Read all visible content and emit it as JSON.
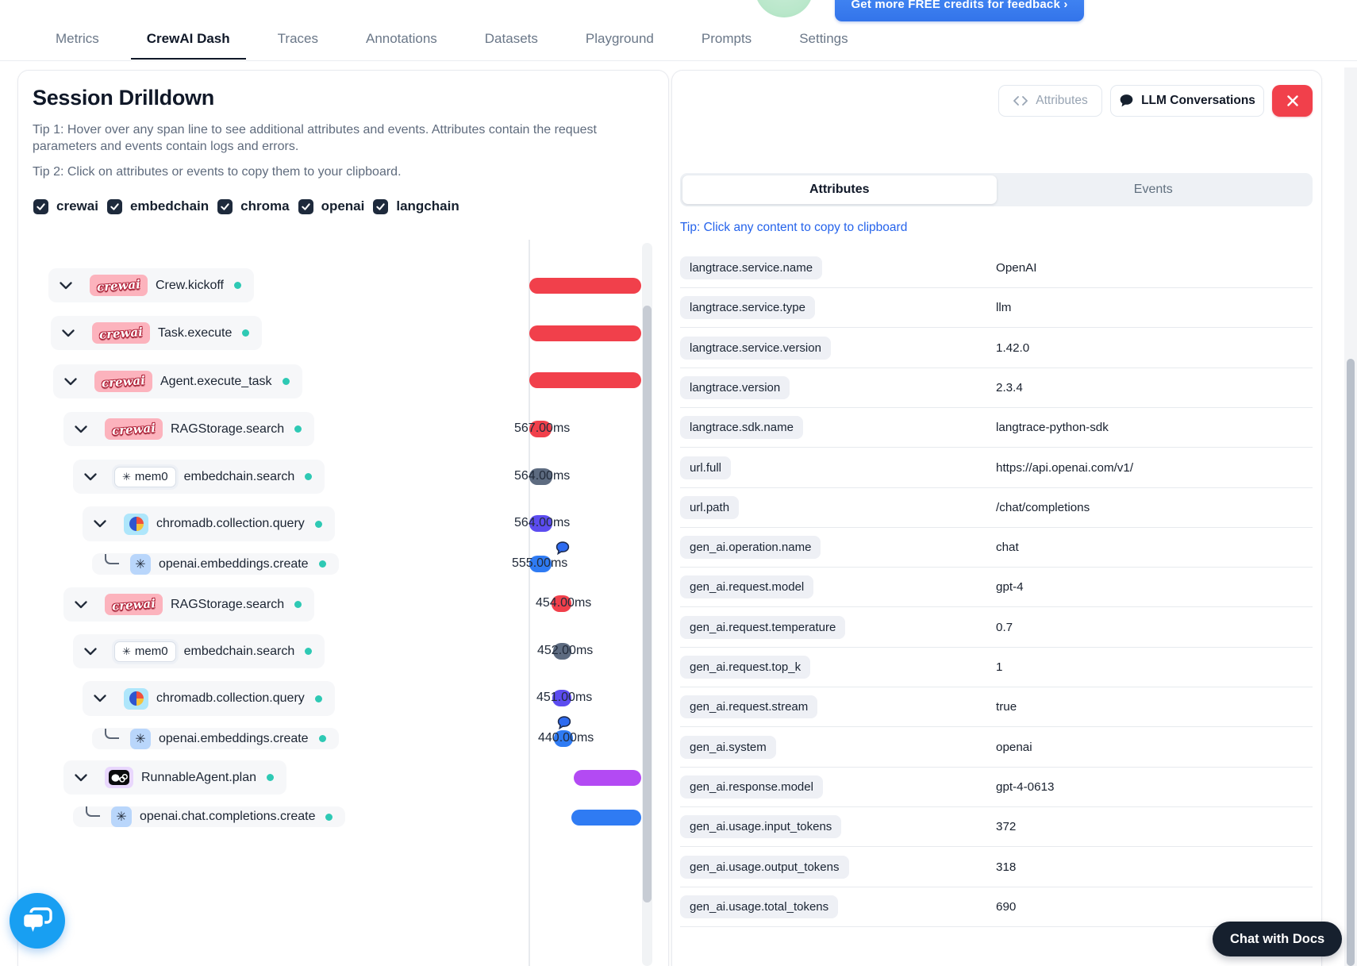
{
  "header": {
    "credits_button_label": "Get more FREE credits for feedback ›",
    "nav_tabs": [
      "Metrics",
      "CrewAI Dash",
      "Traces",
      "Annotations",
      "Datasets",
      "Playground",
      "Prompts",
      "Settings"
    ],
    "active_tab": "CrewAI Dash"
  },
  "session_panel": {
    "title": "Session Drilldown",
    "tip1": "Tip 1: Hover over any span line to see additional attributes and events. Attributes contain the request parameters and events contain logs and errors.",
    "tip2": "Tip 2: Click on attributes or events to copy them to your clipboard.",
    "filters": [
      {
        "label": "crewai",
        "checked": true
      },
      {
        "label": "embedchain",
        "checked": true
      },
      {
        "label": "chroma",
        "checked": true
      },
      {
        "label": "openai",
        "checked": true
      },
      {
        "label": "langchain",
        "checked": true
      }
    ],
    "mem0_badge_label": "mem0",
    "crewai_badge_label": "crewai",
    "spans": [
      {
        "name": "Crew.kickoff",
        "logo": "crewai",
        "duration": "",
        "bar_color": "red"
      },
      {
        "name": "Task.execute",
        "logo": "crewai",
        "duration": "",
        "bar_color": "red"
      },
      {
        "name": "Agent.execute_task",
        "logo": "crewai",
        "duration": "",
        "bar_color": "red"
      },
      {
        "name": "RAGStorage.search",
        "logo": "crewai",
        "duration": "567.00ms",
        "bar_color": "red"
      },
      {
        "name": "embedchain.search",
        "logo": "mem0",
        "duration": "564.00ms",
        "bar_color": "slate"
      },
      {
        "name": "chromadb.collection.query",
        "logo": "chroma",
        "duration": "564.00ms",
        "bar_color": "indigo"
      },
      {
        "name": "openai.embeddings.create",
        "logo": "openai",
        "duration": "555.00ms",
        "bar_color": "blue"
      },
      {
        "name": "RAGStorage.search",
        "logo": "crewai",
        "duration": "454.00ms",
        "bar_color": "red"
      },
      {
        "name": "embedchain.search",
        "logo": "mem0",
        "duration": "452.00ms",
        "bar_color": "slate"
      },
      {
        "name": "chromadb.collection.query",
        "logo": "chroma",
        "duration": "451.00ms",
        "bar_color": "indigo"
      },
      {
        "name": "openai.embeddings.create",
        "logo": "openai",
        "duration": "440.00ms",
        "bar_color": "blue"
      },
      {
        "name": "RunnableAgent.plan",
        "logo": "langchain",
        "duration": "",
        "bar_color": "purple"
      },
      {
        "name": "openai.chat.completions.create",
        "logo": "openai",
        "duration": "",
        "bar_color": "blue"
      }
    ]
  },
  "detail_panel": {
    "attributes_button_label": "Attributes",
    "llm_conversations_button_label": "LLM Conversations",
    "tabs": {
      "attributes": "Attributes",
      "events": "Events"
    },
    "active_tab": "Attributes",
    "copy_tip": "Tip: Click any content to copy to clipboard",
    "attributes": [
      {
        "key": "langtrace.service.name",
        "value": "OpenAI"
      },
      {
        "key": "langtrace.service.type",
        "value": "llm"
      },
      {
        "key": "langtrace.service.version",
        "value": "1.42.0"
      },
      {
        "key": "langtrace.version",
        "value": "2.3.4"
      },
      {
        "key": "langtrace.sdk.name",
        "value": "langtrace-python-sdk"
      },
      {
        "key": "url.full",
        "value": "https://api.openai.com/v1/"
      },
      {
        "key": "url.path",
        "value": "/chat/completions"
      },
      {
        "key": "gen_ai.operation.name",
        "value": "chat"
      },
      {
        "key": "gen_ai.request.model",
        "value": "gpt-4"
      },
      {
        "key": "gen_ai.request.temperature",
        "value": "0.7"
      },
      {
        "key": "gen_ai.request.top_k",
        "value": "1"
      },
      {
        "key": "gen_ai.request.stream",
        "value": "true"
      },
      {
        "key": "gen_ai.system",
        "value": "openai"
      },
      {
        "key": "gen_ai.response.model",
        "value": "gpt-4-0613"
      },
      {
        "key": "gen_ai.usage.input_tokens",
        "value": "372"
      },
      {
        "key": "gen_ai.usage.output_tokens",
        "value": "318"
      },
      {
        "key": "gen_ai.usage.total_tokens",
        "value": "690"
      }
    ]
  },
  "chat_with_docs_label": "Chat with Docs",
  "colors": {
    "red": "#f1404b",
    "slate": "#5d6b80",
    "indigo": "#5c4cf0",
    "blue": "#2f7bf3",
    "purple": "#b34af3",
    "teal": "#2ec9b4",
    "navy_checkbox": "#1e2a3c",
    "tip_blue": "#2563eb",
    "credits_blue": "#3a7df0",
    "close_red": "#f1404b",
    "chat_widget_blue": "#189ff2"
  }
}
